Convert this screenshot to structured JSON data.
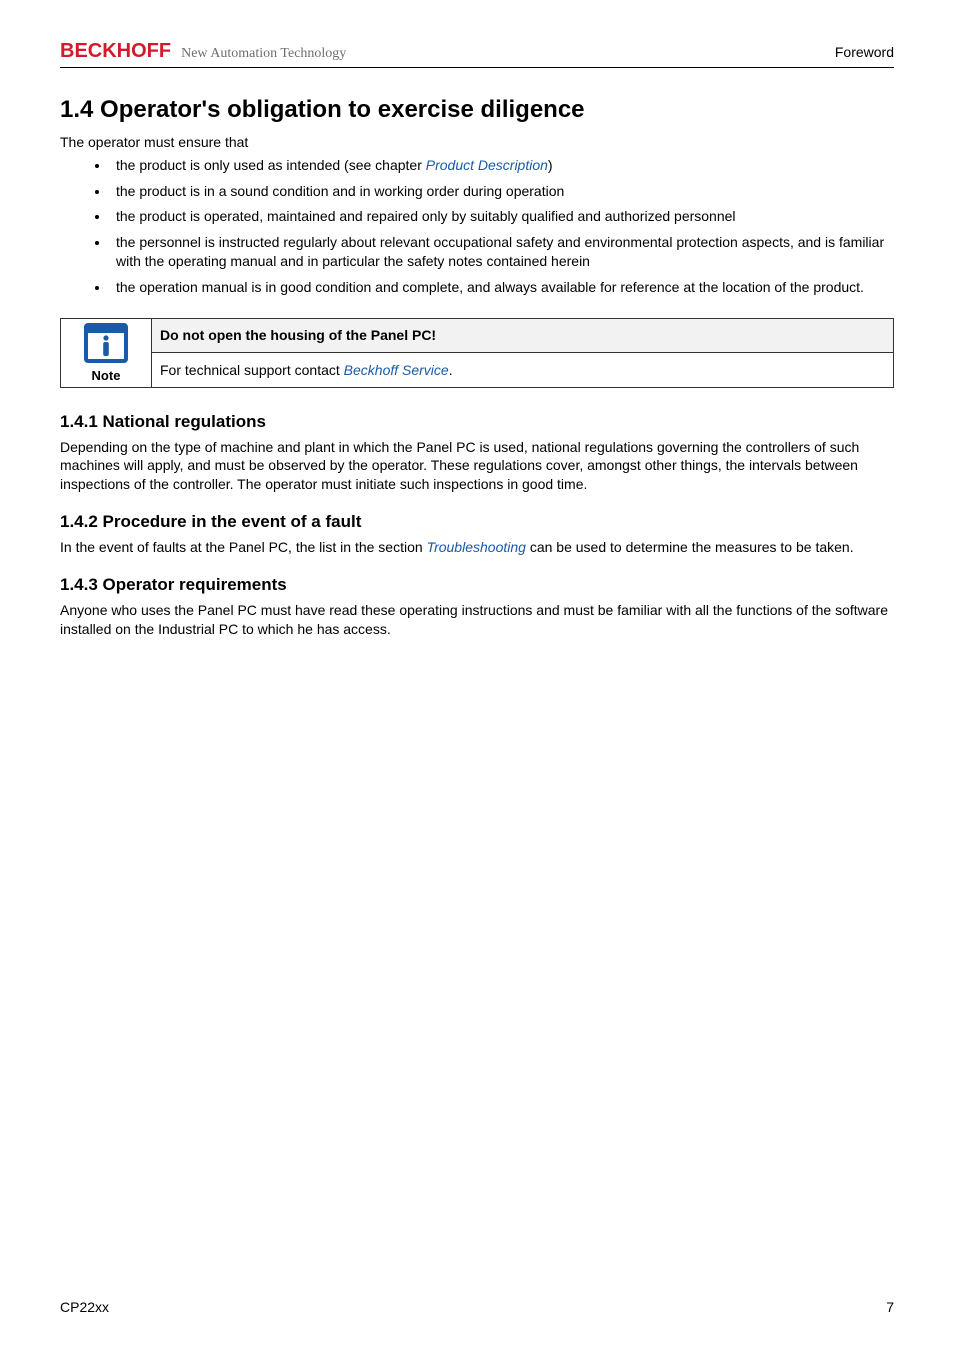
{
  "header": {
    "logo": "BECKHOFF",
    "tagline": "New Automation Technology",
    "chapter": "Foreword"
  },
  "section": {
    "number_title": "1.4 Operator's obligation to exercise diligence",
    "intro": "The operator must ensure that",
    "bullets": [
      {
        "prefix": "the product is only used as intended (see chapter ",
        "link": "Product Description",
        "suffix": ")"
      },
      {
        "text": "the product is in a sound condition and in working order during operation"
      },
      {
        "text": "the product is operated, maintained and repaired only by suitably qualified and authorized personnel"
      },
      {
        "text": "the personnel is instructed regularly about relevant occupational safety and environmental protection aspects, and is familiar with the operating manual and in particular the safety notes contained herein"
      },
      {
        "text": "the operation manual is in good condition and complete, and always available for reference at the location of the product."
      }
    ]
  },
  "note": {
    "caption": "Note",
    "title": "Do not open the housing of the Panel PC!",
    "body_prefix": "For technical support contact ",
    "body_link": "Beckhoff Service",
    "body_suffix": "."
  },
  "sub1": {
    "num_title": "1.4.1  National regulations",
    "body": "Depending on the type of machine and plant in which the Panel PC is used, national regulations governing the controllers of such machines will apply, and must be observed by the operator. These regulations cover, amongst other things, the intervals between inspections of the controller. The operator must initiate such inspections in good time."
  },
  "sub2": {
    "num_title": "1.4.2  Procedure in the event of a fault",
    "body_prefix": "In the event of faults at the Panel PC, the list in the section ",
    "body_link": "Troubleshooting",
    "body_suffix": " can be used to determine the measures to be taken."
  },
  "sub3": {
    "num_title": "1.4.3  Operator requirements",
    "body": "Anyone who uses the Panel PC must have read these operating instructions and must be familiar with all the functions of the software installed on the Industrial PC to which he has access."
  },
  "footer": {
    "left": "CP22xx",
    "right": "7"
  }
}
